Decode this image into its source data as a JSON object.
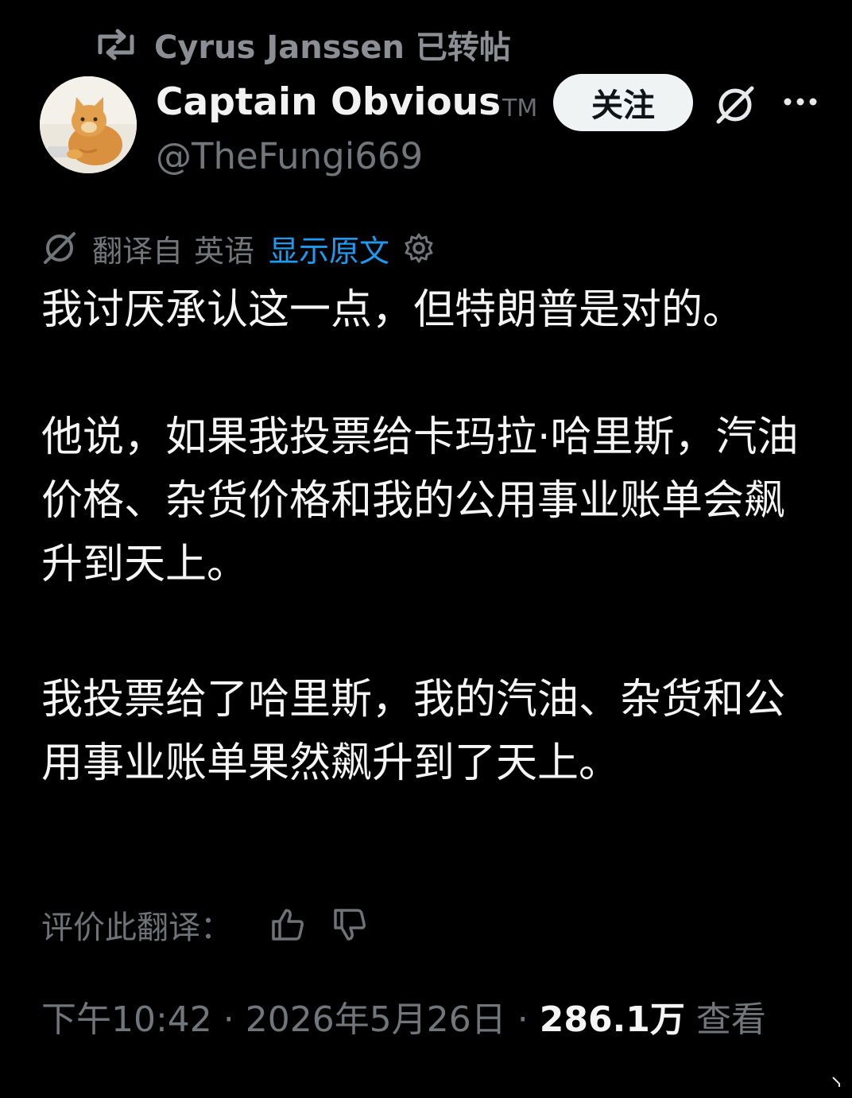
{
  "repost": {
    "text": "Cyrus Janssen 已转帖",
    "icon": "repost-icon"
  },
  "author": {
    "name": "Captain Obvious",
    "badge": "TM",
    "handle": "@TheFungi669",
    "avatar": "cat-avatar"
  },
  "actions": {
    "follow_label": "关注",
    "grok_icon": "grok-icon",
    "more_icon": "more-icon"
  },
  "translation": {
    "prefix": "翻译自",
    "language": "英语",
    "show_original": "显示原文",
    "settings_icon": "gear-icon"
  },
  "tweet": {
    "paragraph1": "我讨厌承认这一点，但特朗普是对的。",
    "paragraph2": "他说，如果我投票给卡玛拉·哈里斯，汽油价格、杂货价格和我的公用事业账单会飙升到天上。",
    "paragraph3": "我投票给了哈里斯，我的汽油、杂货和公用事业账单果然飙升到了天上。"
  },
  "rating": {
    "label": "评价此翻译：",
    "thumbs_up_icon": "thumbs-up-icon",
    "thumbs_down_icon": "thumbs-down-icon"
  },
  "meta": {
    "time": "下午10:42",
    "separator": " · ",
    "date": "2026年5月26日",
    "views_count": "286.1万",
    "views_label": "查看"
  },
  "colors": {
    "background": "#000000",
    "primary_text": "#e7e9ea",
    "secondary_text": "#71767b",
    "link": "#1d9bf0",
    "button_bg": "#eff3f4"
  }
}
